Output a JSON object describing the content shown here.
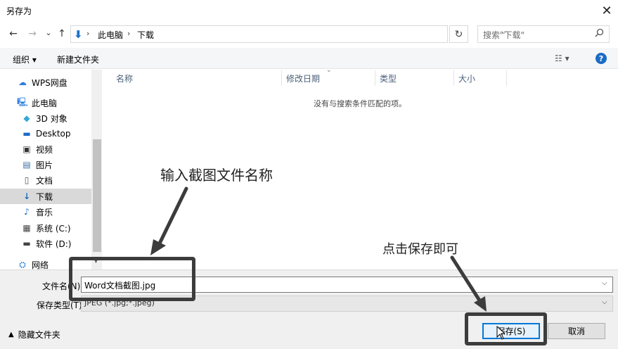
{
  "window": {
    "title": "另存为",
    "close_glyph": "✕"
  },
  "nav_bar": {
    "back_glyph": "←",
    "forward_glyph": "→",
    "recent_glyph": "⌄",
    "up_glyph": "↑",
    "breadcrumb": [
      "此电脑",
      "下载"
    ],
    "separator": "›",
    "refresh_glyph": "↻",
    "search_placeholder": "搜索\"下载\"",
    "search_icon": "⚲"
  },
  "toolbar": {
    "organize": "组织 ▾",
    "new_folder": "新建文件夹",
    "view": "☷ ▾",
    "help": "?"
  },
  "sidebar": {
    "items": [
      {
        "label": "WPS网盘",
        "icon": "☁",
        "selected": false
      },
      {
        "label": "此电脑",
        "icon": "🖳",
        "selected": false
      },
      {
        "label": "3D 对象",
        "icon": "◆",
        "selected": false
      },
      {
        "label": "Desktop",
        "icon": "▬",
        "selected": false
      },
      {
        "label": "视频",
        "icon": "▣",
        "selected": false
      },
      {
        "label": "图片",
        "icon": "▤",
        "selected": false
      },
      {
        "label": "文档",
        "icon": "▯",
        "selected": false
      },
      {
        "label": "下载",
        "icon": "↓",
        "selected": true
      },
      {
        "label": "音乐",
        "icon": "♪",
        "selected": false
      },
      {
        "label": "系统 (C:)",
        "icon": "▦",
        "selected": false
      },
      {
        "label": "软件 (D:)",
        "icon": "▬",
        "selected": false
      },
      {
        "label": "网络",
        "icon": "⛭",
        "selected": false
      }
    ]
  },
  "file_list": {
    "columns": [
      "名称",
      "修改日期",
      "类型",
      "大小"
    ],
    "empty_message": "没有与搜索条件匹配的项。"
  },
  "form": {
    "filename_label": "文件名(N):",
    "filename_value": "Word文档截图.jpg",
    "filetype_label": "保存类型(T):",
    "filetype_value": "JPEG (*.jpg;*.jpeg)",
    "hide_folders": "隐藏文件夹",
    "save_button": "保存(S)",
    "cancel_button": "取消"
  },
  "annotations": {
    "filename_hint": "输入截图文件名称",
    "save_hint": "点击保存即可"
  },
  "colors": {
    "accent": "#0078d7",
    "selected_bg": "#d9d9d9",
    "annotation": "#3c3c3c"
  }
}
